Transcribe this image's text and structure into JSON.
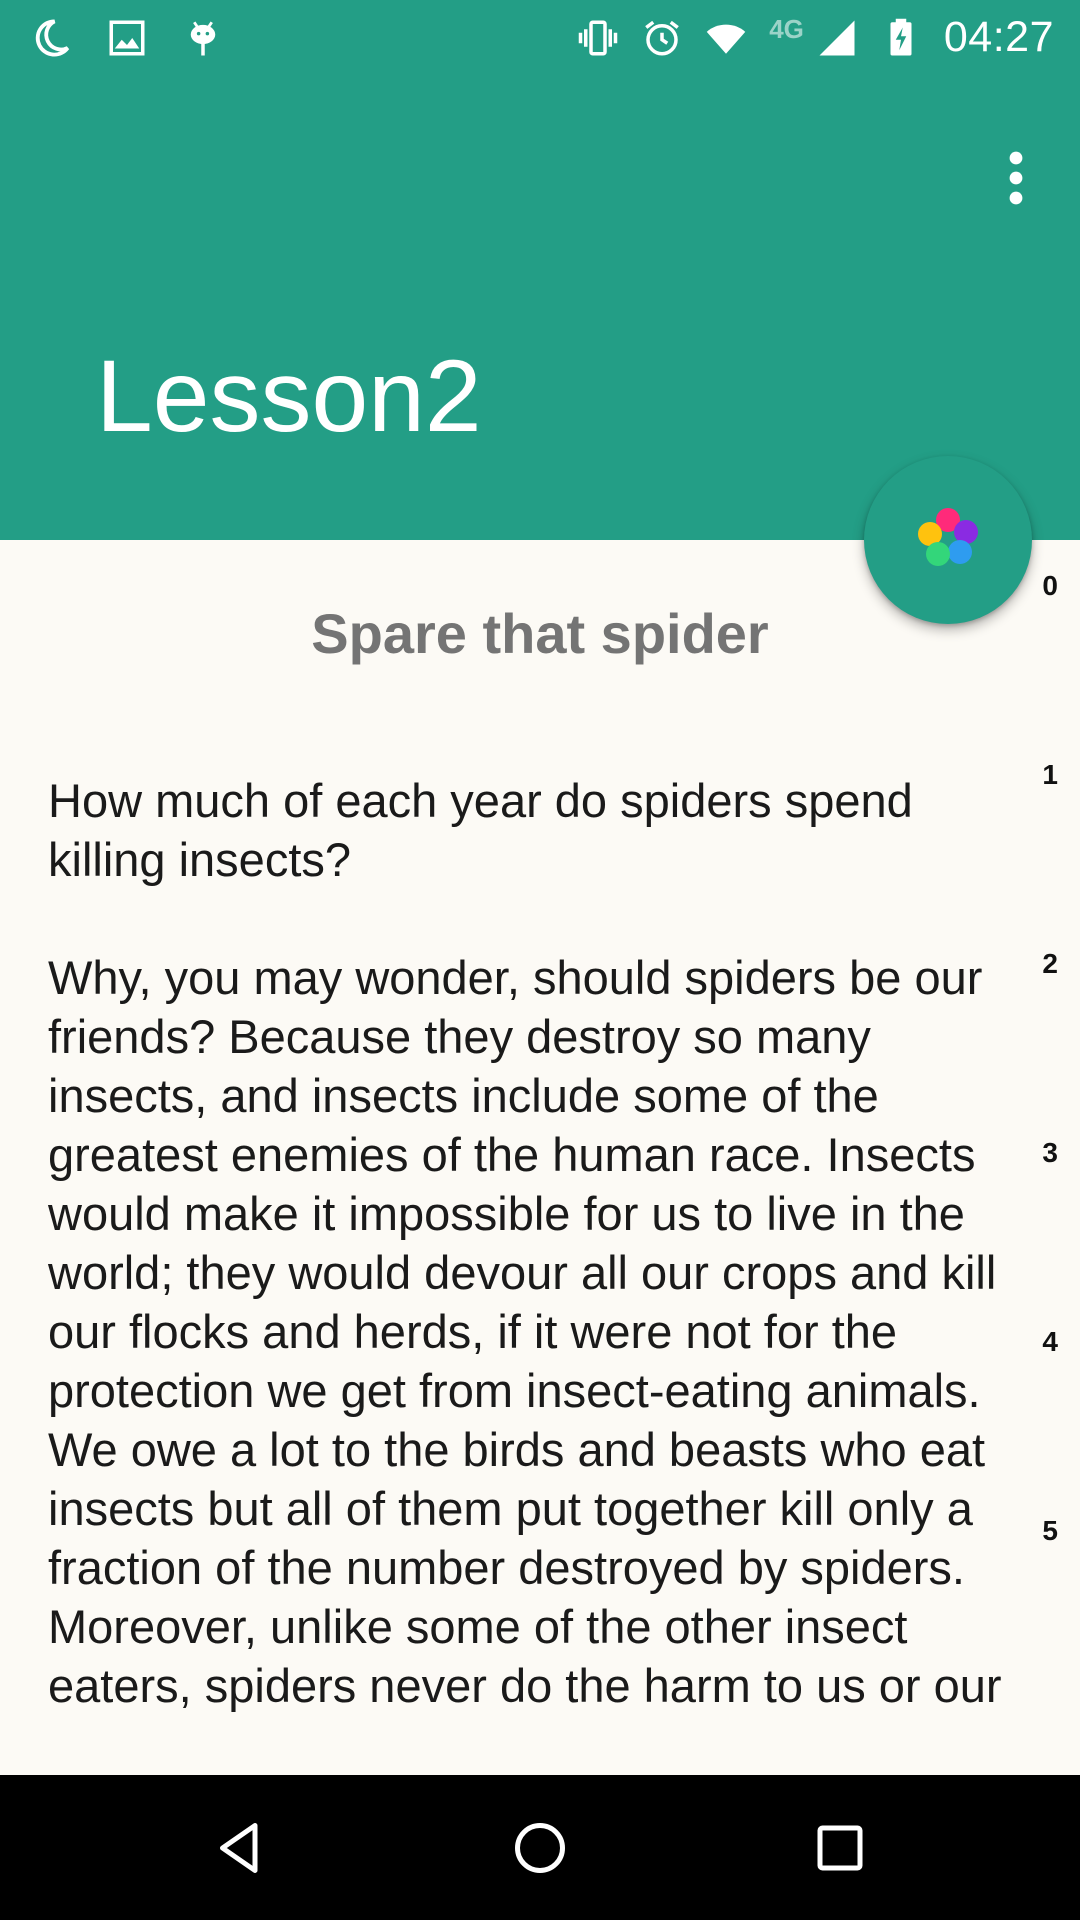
{
  "status_bar": {
    "time": "04:27",
    "network_label": "4G",
    "left_icons": [
      "moon-icon",
      "image-icon",
      "android-icon"
    ],
    "right_icons": [
      "vibrate-icon",
      "alarm-icon",
      "wifi-icon",
      "signal-icon",
      "battery-charging-icon"
    ]
  },
  "app_bar": {
    "title": "Lesson2",
    "menu_icon": "more-vert-icon"
  },
  "fab": {
    "icon": "color-palette-icon",
    "colors": [
      "#ff2a7a",
      "#8a2be2",
      "#ffc20e",
      "#2e9cf0",
      "#33d67a"
    ]
  },
  "content": {
    "subtitle": "Spare that spider",
    "paragraph_1": "How much of each year do spiders spend killing insects?",
    "paragraph_2": "Why, you may wonder, should spiders be our friends? Because they destroy so many insects, and insects include some of the greatest enemies of the human race. Insects would make it impossible for us to live in the world; they would devour all our crops and kill our flocks and herds, if it were not for the protection we get from insect-eating animals. We owe a lot to the birds and beasts who eat insects but all of them put together kill only a fraction of the number destroyed by spiders. Moreover, unlike some of the other insect eaters, spiders never do the harm to us or our",
    "line_numbers": [
      "0",
      "1",
      "2",
      "3",
      "4",
      "5"
    ]
  },
  "nav_bar": {
    "buttons": [
      "back-icon",
      "home-icon",
      "recents-icon"
    ]
  },
  "colors": {
    "primary": "#239e86",
    "background": "#fcfaf5",
    "nav_background": "#000000"
  }
}
